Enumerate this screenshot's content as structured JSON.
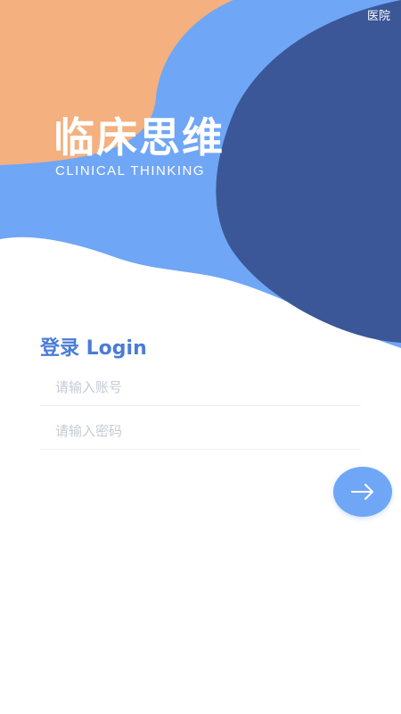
{
  "header": {
    "hospital_label": "医院"
  },
  "brand": {
    "title": "临床思维",
    "subtitle": "CLINICAL THINKING"
  },
  "login": {
    "heading": "登录 Login",
    "account_placeholder": "请输入账号",
    "password_placeholder": "请输入密码",
    "submit_icon": "arrow-right-icon"
  },
  "colors": {
    "orange": "#f4b07e",
    "light_blue": "#6fa6f5",
    "dark_blue": "#3b5797",
    "accent": "#4a7cd8"
  }
}
